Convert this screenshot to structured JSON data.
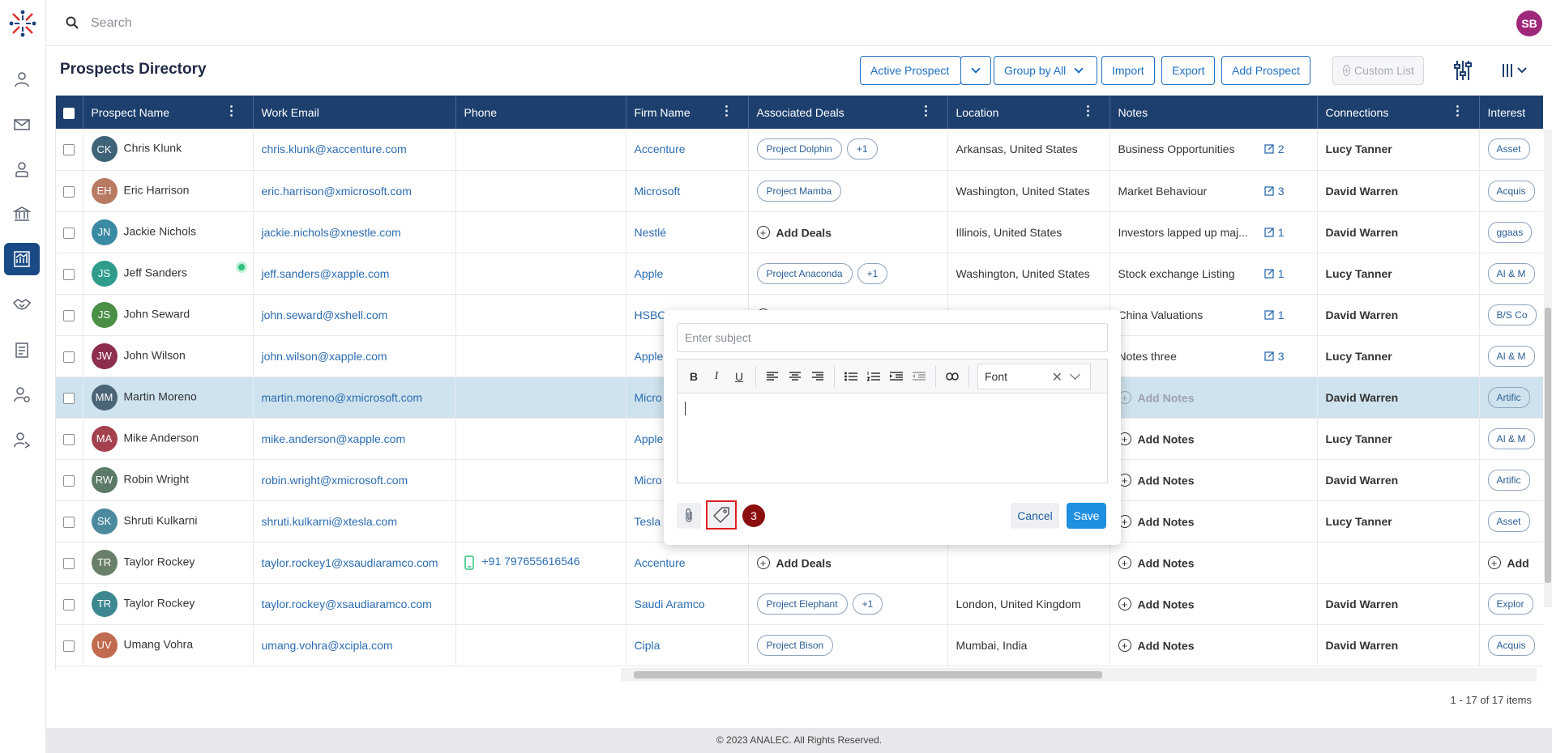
{
  "search": {
    "placeholder": "Search"
  },
  "user": {
    "initials": "SB"
  },
  "page": {
    "title": "Prospects Directory"
  },
  "toolbar": {
    "active_prospect": "Active Prospect",
    "group_by": "Group by All",
    "import": "Import",
    "export": "Export",
    "add_prospect": "Add Prospect",
    "custom_list": "Custom List"
  },
  "columns": [
    "Prospect Name",
    "Work Email",
    "Phone",
    "Firm Name",
    "Associated Deals",
    "Location",
    "Notes",
    "Connections",
    "Interest"
  ],
  "add_deals_label": "Add Deals",
  "add_notes_label": "Add Notes",
  "rows": [
    {
      "initials": "CK",
      "color": "#3f6378",
      "name": "Chris Klunk",
      "email": "chris.klunk@xaccenture.com",
      "phone": "",
      "firm": "Accenture",
      "deals": [
        "Project Dolphin",
        "+1"
      ],
      "location": "Arkansas, United States",
      "note": "Business Opportunities",
      "note_count": "2",
      "connection": "Lucy Tanner",
      "interest": "Asset"
    },
    {
      "initials": "EH",
      "color": "#b97a63",
      "name": "Eric Harrison",
      "email": "eric.harrison@xmicrosoft.com",
      "phone": "",
      "firm": "Microsoft",
      "deals": [
        "Project Mamba"
      ],
      "location": "Washington, United States",
      "note": "Market Behaviour",
      "note_count": "3",
      "connection": "David Warren",
      "interest": "Acquis"
    },
    {
      "initials": "JN",
      "color": "#3b8aa4",
      "name": "Jackie Nichols",
      "email": "jackie.nichols@xnestle.com",
      "phone": "",
      "firm": "Nestlé",
      "deals": [],
      "location": "Illinois, United States",
      "note": "Investors lapped up maj...",
      "note_count": "1",
      "connection": "David Warren",
      "interest": "ggaas"
    },
    {
      "initials": "JS",
      "color": "#2f9c8c",
      "name": "Jeff Sanders",
      "email": "jeff.sanders@xapple.com",
      "phone": "",
      "firm": "Apple",
      "deals": [
        "Project Anaconda",
        "+1"
      ],
      "location": "Washington, United States",
      "note": "Stock exchange Listing",
      "note_count": "1",
      "connection": "Lucy Tanner",
      "interest": "AI & M",
      "online": true
    },
    {
      "initials": "JS",
      "color": "#4a8f45",
      "name": "John Seward",
      "email": "john.seward@xshell.com",
      "phone": "",
      "firm": "HSBC",
      "deals": [],
      "location": "",
      "note": "China Valuations",
      "note_count": "1",
      "connection": "David Warren",
      "interest": "B/S Co"
    },
    {
      "initials": "JW",
      "color": "#8e2e4d",
      "name": "John Wilson",
      "email": "john.wilson@xapple.com",
      "phone": "",
      "firm": "Apple",
      "deals": [],
      "location": "",
      "note": "Notes three",
      "note_count": "3",
      "connection": "Lucy Tanner",
      "interest": "AI & M"
    },
    {
      "initials": "MM",
      "color": "#4b6476",
      "name": "Martin Moreno",
      "email": "martin.moreno@xmicrosoft.com",
      "phone": "",
      "firm": "Micro",
      "deals": [],
      "location": "",
      "note": "",
      "note_count": "",
      "connection": "David Warren",
      "interest": "Artific",
      "selected": true
    },
    {
      "initials": "MA",
      "color": "#a4414f",
      "name": "Mike Anderson",
      "email": "mike.anderson@xapple.com",
      "phone": "",
      "firm": "Apple",
      "deals": [],
      "location": "",
      "note": "",
      "note_count": "",
      "connection": "Lucy Tanner",
      "interest": "AI & M"
    },
    {
      "initials": "RW",
      "color": "#5b7a67",
      "name": "Robin Wright",
      "email": "robin.wright@xmicrosoft.com",
      "phone": "",
      "firm": "Micro",
      "deals": [],
      "location": "",
      "note": "",
      "note_count": "",
      "connection": "David Warren",
      "interest": "Artific"
    },
    {
      "initials": "SK",
      "color": "#4b8a9e",
      "name": "Shruti Kulkarni",
      "email": "shruti.kulkarni@xtesla.com",
      "phone": "",
      "firm": "Tesla",
      "deals": [],
      "location": "",
      "note": "",
      "note_count": "",
      "connection": "Lucy Tanner",
      "interest": "Asset"
    },
    {
      "initials": "TR",
      "color": "#6a7f6a",
      "name": "Taylor Rockey",
      "email": "taylor.rockey1@xsaudiaramco.com",
      "phone": "+91 797655616546",
      "firm": "Accenture",
      "deals": [],
      "location": "",
      "note": "",
      "note_count": "",
      "connection": "",
      "interest": ""
    },
    {
      "initials": "TR",
      "color": "#3d8790",
      "name": "Taylor Rockey",
      "email": "taylor.rockey@xsaudiaramco.com",
      "phone": "",
      "firm": "Saudi Aramco",
      "deals": [
        "Project Elephant",
        "+1"
      ],
      "location": "London, United Kingdom",
      "note": "",
      "note_count": "",
      "connection": "David Warren",
      "interest": "Explor"
    },
    {
      "initials": "UV",
      "color": "#c06a4f",
      "name": "Umang Vohra",
      "email": "umang.vohra@xcipla.com",
      "phone": "",
      "firm": "Cipla",
      "deals": [
        "Project Bison"
      ],
      "location": "Mumbai, India",
      "note": "",
      "note_count": "",
      "connection": "David Warren",
      "interest": "Acquis"
    }
  ],
  "interest_add_label": "Add",
  "pager": "1 - 17 of 17 items",
  "footer": "© 2023 ANALEC. All Rights Reserved.",
  "notes_popup": {
    "subject_placeholder": "Enter subject",
    "font_label": "Font",
    "tag_badge": "3",
    "cancel": "Cancel",
    "save": "Save"
  }
}
